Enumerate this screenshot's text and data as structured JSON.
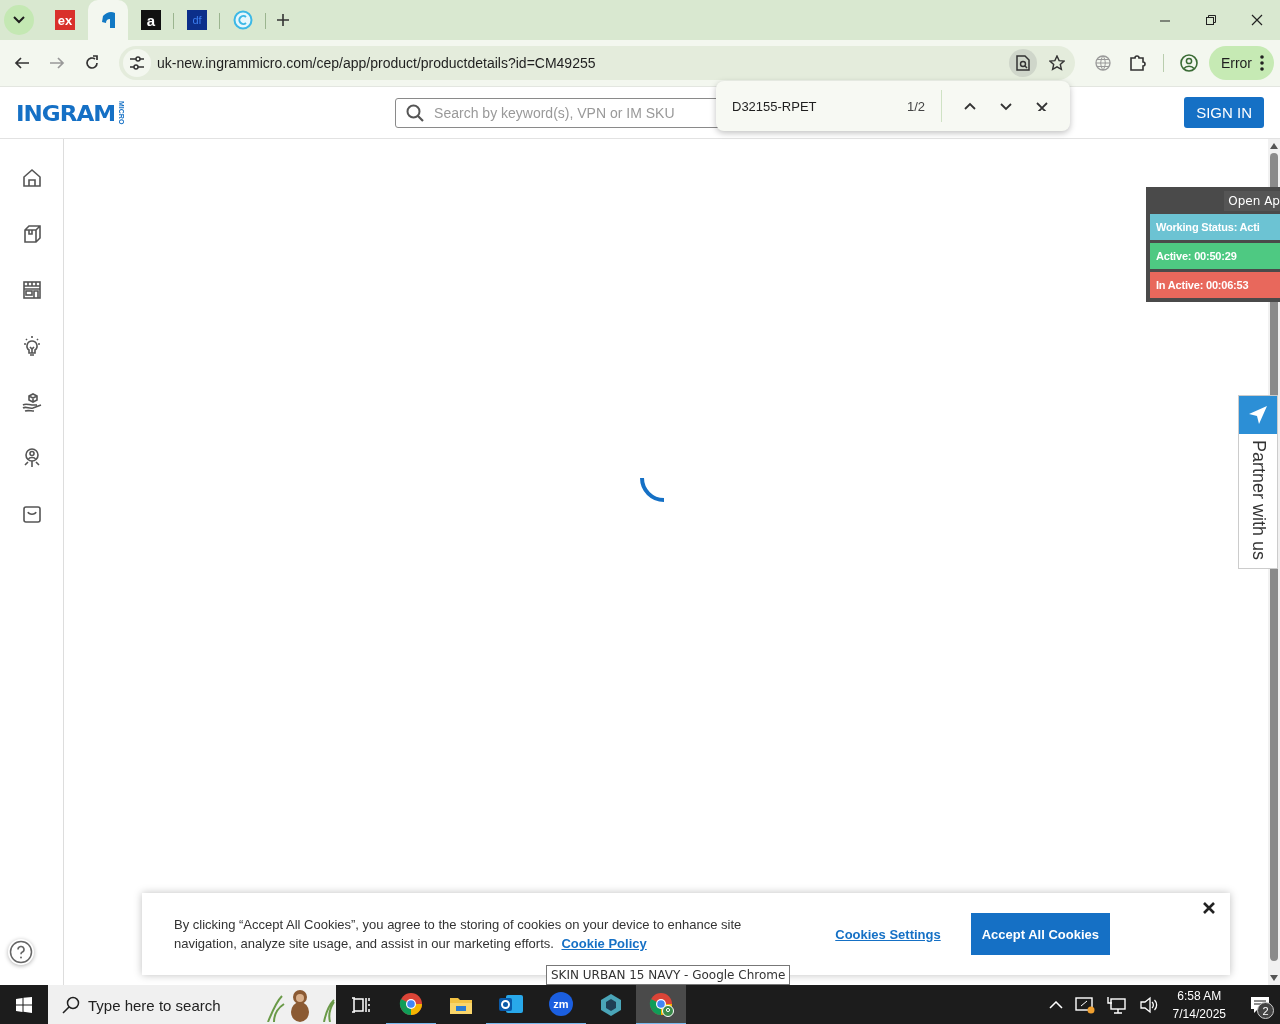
{
  "browser": {
    "tabs": [
      {
        "kind": "ex",
        "icon_text": "ex",
        "selected": false
      },
      {
        "kind": "ingram",
        "selected": true
      },
      {
        "kind": "amazon",
        "icon_text": "a",
        "selected": false
      },
      {
        "kind": "df",
        "icon_text": "df",
        "selected": false
      },
      {
        "kind": "copyright",
        "selected": false
      }
    ],
    "address": "uk-new.ingrammicro.com/cep/app/product/productdetails?id=CM49255",
    "profile_button": "Error"
  },
  "find_bar": {
    "query": "D32155-RPET",
    "count": "1/2"
  },
  "site": {
    "logo": {
      "name": "INGRAM",
      "sub": "MICRO"
    },
    "search": {
      "placeholder": "Search by keyword(s), VPN or IM SKU"
    },
    "sign_in": "SIGN IN"
  },
  "tracker": {
    "open_button": "Open Ap",
    "rows": [
      {
        "text": "Working Status: Acti",
        "color": "#6cc3d3"
      },
      {
        "text": "Active: 00:50:29",
        "color": "#4ec982"
      },
      {
        "text": "In Active: 00:06:53",
        "color": "#e8685c"
      }
    ]
  },
  "partner_tab": "Partner with us",
  "cookie_banner": {
    "text": "By clicking “Accept All Cookies”, you agree to the storing of cookies on your device to enhance site navigation, analyze site usage, and assist in our marketing efforts.",
    "link": "Cookie Policy",
    "settings_button": "Cookies Settings",
    "accept_button": "Accept All Cookies"
  },
  "tooltip": "SKIN URBAN 15 NAVY - Google Chrome",
  "taskbar": {
    "search_placeholder": "Type here to search",
    "apps": [
      {
        "kind": "task-view",
        "selected": false
      },
      {
        "kind": "chrome",
        "selected": false
      },
      {
        "kind": "files",
        "selected": false
      },
      {
        "kind": "outlook",
        "selected": false
      },
      {
        "kind": "zoom",
        "label": "zm",
        "selected": false
      },
      {
        "kind": "cube",
        "selected": false
      },
      {
        "kind": "chrome-profile",
        "selected": true
      }
    ],
    "time": "6:58 AM",
    "date": "7/14/2025",
    "notifications": "2"
  }
}
